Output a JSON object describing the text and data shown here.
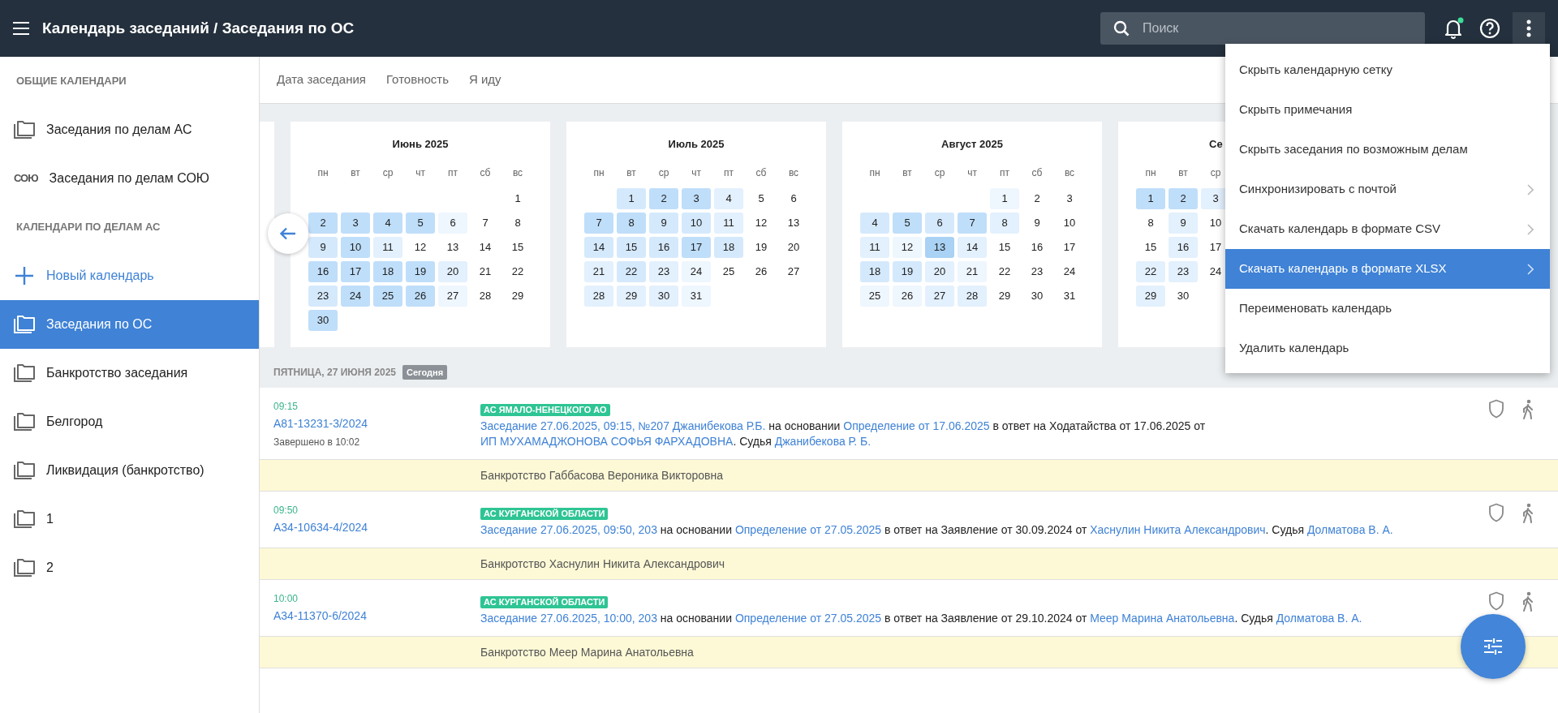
{
  "topbar": {
    "title": "Календарь заседаний / Заседания по ОС",
    "search": {
      "placeholder": "Поиск"
    },
    "notifications": {
      "unread": true
    },
    "more_menu_open": true
  },
  "sidebar": {
    "items": [
      {
        "kind": "header",
        "label": "ОБЩИЕ КАЛЕНДАРИ"
      },
      {
        "kind": "folder",
        "label": "Заседания по делам АС",
        "selected": false
      },
      {
        "kind": "logo",
        "icon_text": "СОЮ",
        "label": "Заседания по делам СОЮ",
        "selected": false
      },
      {
        "kind": "header",
        "label": "КАЛЕНДАРИ ПО ДЕЛАМ АС"
      },
      {
        "kind": "add",
        "label": "Новый календарь"
      },
      {
        "kind": "folder",
        "label": "Заседания по ОС",
        "selected": true
      },
      {
        "kind": "folder",
        "label": "Банкротство заседания",
        "selected": false
      },
      {
        "kind": "folder",
        "label": "Белгород",
        "selected": false
      },
      {
        "kind": "folder",
        "label": "Ликвидация (банкротство)",
        "selected": false
      },
      {
        "kind": "folder",
        "label": "1",
        "selected": false
      },
      {
        "kind": "folder",
        "label": "2",
        "selected": false
      }
    ]
  },
  "sort_tabs": [
    "Дата заседания",
    "Готовность",
    "Я иду"
  ],
  "months": [
    {
      "title": "Июнь 2025",
      "weekdays": [
        "пн",
        "вт",
        "ср",
        "чт",
        "пт",
        "сб",
        "вс"
      ],
      "weeks": [
        [
          {
            "day": "1"
          }
        ],
        [
          {
            "day": "2",
            "color": "#bfdefa"
          },
          {
            "day": "3",
            "color": "#bfdefa"
          },
          {
            "day": "4",
            "color": "#bfdefa"
          },
          {
            "day": "5",
            "color": "#bfdefa"
          },
          {
            "day": "6",
            "color": "#eef6fe"
          },
          {
            "day": "7"
          },
          {
            "day": "8"
          }
        ],
        [
          {
            "day": "9",
            "color": "#d5e9fc"
          },
          {
            "day": "10",
            "color": "#bfdefa"
          },
          {
            "day": "11",
            "color": "#e3f0fd"
          },
          {
            "day": "12"
          },
          {
            "day": "13"
          },
          {
            "day": "14"
          },
          {
            "day": "15"
          }
        ],
        [
          {
            "day": "16",
            "color": "#bfdefa"
          },
          {
            "day": "17",
            "color": "#bfdefa"
          },
          {
            "day": "18",
            "color": "#bfdefa"
          },
          {
            "day": "19",
            "color": "#bfdefa"
          },
          {
            "day": "20",
            "color": "#e3f0fd"
          },
          {
            "day": "21"
          },
          {
            "day": "22"
          }
        ],
        [
          {
            "day": "23",
            "color": "#d5e9fc"
          },
          {
            "day": "24",
            "color": "#bfdefa"
          },
          {
            "day": "25",
            "color": "#bfdefa"
          },
          {
            "day": "26",
            "color": "#bfdefa"
          },
          {
            "day": "27",
            "color": "#eef6fe"
          },
          {
            "day": "28"
          },
          {
            "day": "29"
          }
        ],
        [
          {
            "day": "30",
            "color": "#bfdefa"
          }
        ]
      ]
    },
    {
      "title": "Июль 2025",
      "weekdays": [
        "пн",
        "вт",
        "ср",
        "чт",
        "пт",
        "сб",
        "вс"
      ],
      "weeks": [
        [
          {
            "day": "1",
            "color": "#d5e9fc"
          },
          {
            "day": "2",
            "color": "#bfdefa"
          },
          {
            "day": "3",
            "color": "#bfdefa"
          },
          {
            "day": "4",
            "color": "#e3f0fd"
          },
          {
            "day": "5"
          },
          {
            "day": "6"
          }
        ],
        [
          {
            "day": "7",
            "color": "#bfdefa"
          },
          {
            "day": "8",
            "color": "#bfdefa"
          },
          {
            "day": "9",
            "color": "#d5e9fc"
          },
          {
            "day": "10",
            "color": "#d5e9fc"
          },
          {
            "day": "11",
            "color": "#e3f0fd"
          },
          {
            "day": "12"
          },
          {
            "day": "13"
          }
        ],
        [
          {
            "day": "14",
            "color": "#d5e9fc"
          },
          {
            "day": "15",
            "color": "#d5e9fc"
          },
          {
            "day": "16",
            "color": "#d5e9fc"
          },
          {
            "day": "17",
            "color": "#bfdefa"
          },
          {
            "day": "18",
            "color": "#d5e9fc"
          },
          {
            "day": "19"
          },
          {
            "day": "20"
          }
        ],
        [
          {
            "day": "21",
            "color": "#e3f0fd"
          },
          {
            "day": "22",
            "color": "#d5e9fc"
          },
          {
            "day": "23",
            "color": "#e3f0fd"
          },
          {
            "day": "24",
            "color": "#eef6fe"
          },
          {
            "day": "25"
          },
          {
            "day": "26"
          },
          {
            "day": "27"
          }
        ],
        [
          {
            "day": "28",
            "color": "#e3f0fd"
          },
          {
            "day": "29",
            "color": "#e3f0fd"
          },
          {
            "day": "30",
            "color": "#e3f0fd"
          },
          {
            "day": "31",
            "color": "#eef6fe"
          }
        ]
      ]
    },
    {
      "title": "Август 2025",
      "weekdays": [
        "пн",
        "вт",
        "ср",
        "чт",
        "пт",
        "сб",
        "вс"
      ],
      "weeks": [
        [
          {
            "day": "1",
            "color": "#eef6fe"
          },
          {
            "day": "2"
          },
          {
            "day": "3"
          }
        ],
        [
          {
            "day": "4",
            "color": "#d5e9fc"
          },
          {
            "day": "5",
            "color": "#bfdefa"
          },
          {
            "day": "6",
            "color": "#d5e9fc"
          },
          {
            "day": "7",
            "color": "#bfdefa"
          },
          {
            "day": "8",
            "color": "#e3f0fd"
          },
          {
            "day": "9"
          },
          {
            "day": "10"
          }
        ],
        [
          {
            "day": "11",
            "color": "#e3f0fd"
          },
          {
            "day": "12",
            "color": "#eef6fe"
          },
          {
            "day": "13",
            "color": "#a9d2f5"
          },
          {
            "day": "14",
            "color": "#e3f0fd"
          },
          {
            "day": "15"
          },
          {
            "day": "16"
          },
          {
            "day": "17"
          }
        ],
        [
          {
            "day": "18",
            "color": "#d5e9fc"
          },
          {
            "day": "19",
            "color": "#d5e9fc"
          },
          {
            "day": "20",
            "color": "#e3f0fd"
          },
          {
            "day": "21",
            "color": "#eef6fe"
          },
          {
            "day": "22"
          },
          {
            "day": "23"
          },
          {
            "day": "24"
          }
        ],
        [
          {
            "day": "25",
            "color": "#eef6fe"
          },
          {
            "day": "26",
            "color": "#eef6fe"
          },
          {
            "day": "27",
            "color": "#e3f0fd"
          },
          {
            "day": "28",
            "color": "#e3f0fd"
          },
          {
            "day": "29"
          },
          {
            "day": "30"
          },
          {
            "day": "31"
          }
        ]
      ]
    },
    {
      "title": "Се",
      "weekdays": [
        "пн",
        "вт",
        "ср"
      ],
      "weeks": [
        [
          {
            "day": "1",
            "color": "#bfdefa"
          },
          {
            "day": "2",
            "color": "#bfdefa"
          },
          {
            "day": "3",
            "color": "#e3f0fd"
          }
        ],
        [
          {
            "day": "8"
          },
          {
            "day": "9",
            "color": "#e3f0fd"
          },
          {
            "day": "10"
          }
        ],
        [
          {
            "day": "15"
          },
          {
            "day": "16",
            "color": "#e3f0fd"
          },
          {
            "day": "17"
          }
        ],
        [
          {
            "day": "22",
            "color": "#e3f0fd"
          },
          {
            "day": "23",
            "color": "#e3f0fd"
          },
          {
            "day": "24"
          }
        ],
        [
          {
            "day": "29",
            "color": "#e3f0fd"
          },
          {
            "day": "30"
          }
        ]
      ]
    }
  ],
  "day_header": {
    "date": "ПЯТНИЦА, 27 ИЮНЯ 2025",
    "badge": "Сегодня"
  },
  "events": [
    {
      "time": "09:15",
      "case": "А81-13231-3/2024",
      "status": "Завершено в 10:02",
      "court": "АС ЯМАЛО-НЕНЕЦКОГО АО",
      "description": [
        {
          "text": "Заседание 27.06.2025, 09:15, №207 Джанибекова Р.Б.",
          "link": true
        },
        {
          "text": " на основании ",
          "link": false
        },
        {
          "text": "Определение от 17.06.2025",
          "link": true
        },
        {
          "text": " в ответ на Ходатайства от 17.06.2025 от ",
          "link": false
        },
        {
          "text": "ИП МУХАМАДЖОНОВА СОФЬЯ ФАРХАДОВНА",
          "link": true
        },
        {
          "text": ". Судья ",
          "link": false
        },
        {
          "text": "Джанибекова Р. Б.",
          "link": true
        }
      ],
      "note": "Банкротство Габбасова Вероника Викторовна"
    },
    {
      "time": "09:50",
      "case": "А34-10634-4/2024",
      "court": "АС КУРГАНСКОЙ ОБЛАСТИ",
      "description": [
        {
          "text": "Заседание 27.06.2025, 09:50, 203",
          "link": true
        },
        {
          "text": " на основании ",
          "link": false
        },
        {
          "text": "Определение от 27.05.2025",
          "link": true
        },
        {
          "text": " в ответ на Заявление от 30.09.2024 от ",
          "link": false
        },
        {
          "text": "Хаснулин Никита Александрович",
          "link": true
        },
        {
          "text": ". Судья ",
          "link": false
        },
        {
          "text": "Долматова В. А.",
          "link": true
        }
      ],
      "note": "Банкротство Хаснулин Никита Александрович"
    },
    {
      "time": "10:00",
      "case": "А34-11370-6/2024",
      "court": "АС КУРГАНСКОЙ ОБЛАСТИ",
      "description": [
        {
          "text": "Заседание 27.06.2025, 10:00, 203",
          "link": true
        },
        {
          "text": " на основании ",
          "link": false
        },
        {
          "text": "Определение от 27.05.2025",
          "link": true
        },
        {
          "text": " в ответ на Заявление от 29.10.2024 от ",
          "link": false
        },
        {
          "text": "Меер Марина Анатольевна",
          "link": true
        },
        {
          "text": ". Судья ",
          "link": false
        },
        {
          "text": "Долматова В. А.",
          "link": true
        }
      ],
      "note": "Банкротство Меер Марина Анатольевна"
    }
  ],
  "menu": {
    "items": [
      {
        "label": "Скрыть календарную сетку",
        "submenu": false,
        "selected": false
      },
      {
        "label": "Скрыть примечания",
        "submenu": false,
        "selected": false
      },
      {
        "label": "Скрыть заседания по возможным делам",
        "submenu": false,
        "selected": false
      },
      {
        "label": "Синхронизировать с почтой",
        "submenu": true,
        "selected": false
      },
      {
        "label": "Скачать календарь в формате CSV",
        "submenu": true,
        "selected": false
      },
      {
        "label": "Скачать календарь в формате XLSX",
        "submenu": true,
        "selected": true
      },
      {
        "label": "Переименовать календарь",
        "submenu": false,
        "selected": false
      },
      {
        "label": "Удалить календарь",
        "submenu": false,
        "selected": false
      }
    ]
  }
}
